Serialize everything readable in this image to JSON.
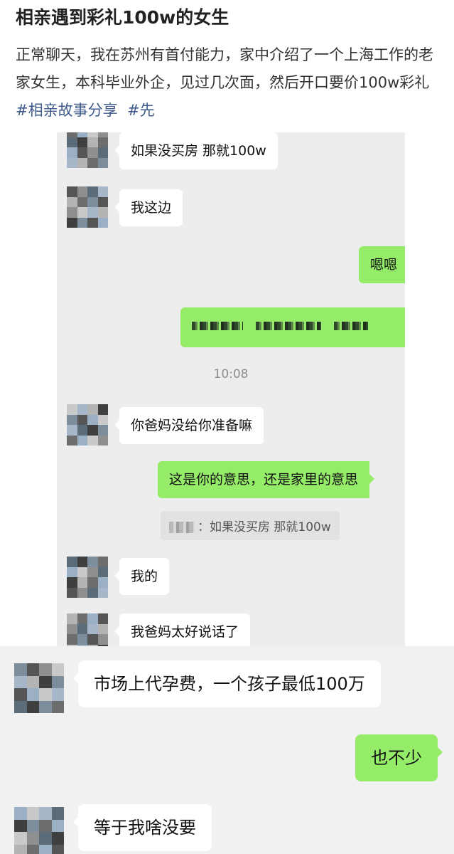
{
  "post": {
    "title": "相亲遇到彩礼100w的女生",
    "description": "正常聊天，我在苏州有首付能力，家中介绍了一个上海工作的老家女生，本科毕业外企，见过几次面，然后开口要价100w彩礼 ",
    "tags": [
      "#相亲故事分享",
      "#先"
    ]
  },
  "chat": {
    "messages": [
      {
        "side": "in",
        "text": "如果没买房  那就100w"
      },
      {
        "side": "in",
        "text": "我这边"
      },
      {
        "side": "out",
        "text": "嗯嗯"
      },
      {
        "side": "out",
        "text": "",
        "pixelated": true
      },
      {
        "side": "in",
        "text": "你爸妈没给你准备嘛"
      },
      {
        "side": "out",
        "text": "这是你的意思，还是家里的意思"
      },
      {
        "side": "in",
        "text": "我的"
      },
      {
        "side": "in",
        "text": "我爸妈太好说话了"
      }
    ],
    "timestamp": "10:08",
    "quote": "：如果没买房  那就100w"
  },
  "chat2": {
    "messages": [
      {
        "side": "in",
        "text": "市场上代孕费，一个孩子最低100万"
      },
      {
        "side": "out",
        "text": "也不少"
      },
      {
        "side": "in",
        "text": "等于我啥没要"
      }
    ]
  },
  "colors": {
    "outgoing_bubble": "#95ec69",
    "incoming_bubble": "#ffffff",
    "chat_background": "#ededed",
    "tag_link": "#3f5a8c"
  },
  "icons": {
    "avatar": "pixelated-avatar"
  }
}
